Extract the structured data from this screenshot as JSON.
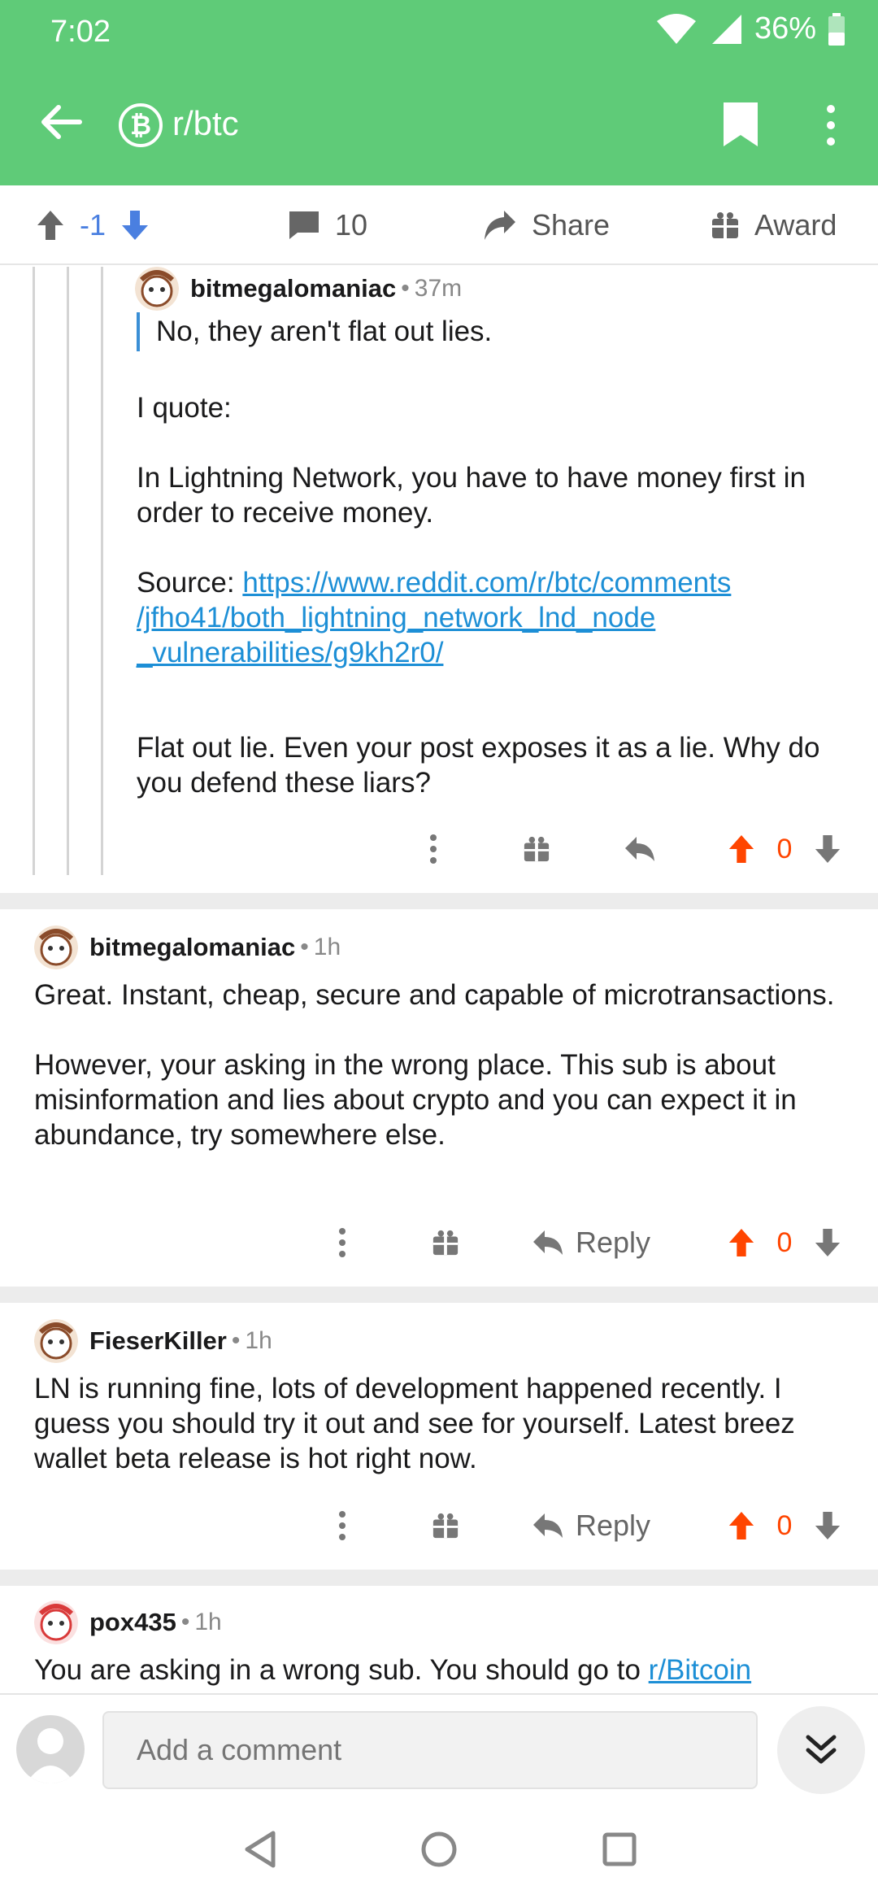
{
  "status": {
    "time": "7:02",
    "battery": "36%"
  },
  "header": {
    "subreddit": "r/btc",
    "badge": "₿"
  },
  "post_actions": {
    "score": "-1",
    "comments": "10",
    "share": "Share",
    "award": "Award"
  },
  "comments": [
    {
      "author": "bitmegalomaniac",
      "age": "37m",
      "quote": "No, they aren't flat out lies.",
      "text_before_link": "I quote:\n\nIn Lightning Network, you have to have money first in order to receive money.\n\nSource: ",
      "link": "https://www.reddit.com/r/btc/comments\n/jfho41/both_lightning_network_lnd_node\n_vulnerabilities/g9kh2r0/",
      "text_after_link": "Flat out lie.  Even your post exposes it as a lie.  Why do you defend these liars?",
      "score": "0"
    },
    {
      "author": "bitmegalomaniac",
      "age": "1h",
      "text": "Great.  Instant, cheap, secure and capable of microtransactions.\n\nHowever, your asking in the wrong place.  This sub is about misinformation and lies about crypto and you can expect it in abundance, try somewhere else.",
      "reply": "Reply",
      "score": "0"
    },
    {
      "author": "FieserKiller",
      "age": "1h",
      "text": "LN is running fine, lots of development happened recently. I guess you should try it out and see for yourself. Latest breez wallet beta release is hot right now.",
      "reply": "Reply",
      "score": "0"
    },
    {
      "author": "pox435",
      "age": "1h",
      "text": "You are asking in a wrong sub. You should go to ",
      "link": "r/Bitcoin"
    }
  ],
  "comment_bar": {
    "placeholder": "Add a comment"
  },
  "colors": {
    "header": "#5fcb78",
    "upvote": "#ff4500",
    "link": "#1d8fd6",
    "downvote_blue": "#4a7fe0"
  },
  "icons": [
    "back-arrow-icon",
    "bitcoin-icon",
    "bookmark-icon",
    "more-vertical-icon",
    "upvote-icon",
    "downvote-icon",
    "comment-icon",
    "share-icon",
    "gift-icon",
    "reply-icon",
    "double-chevron-down-icon"
  ]
}
